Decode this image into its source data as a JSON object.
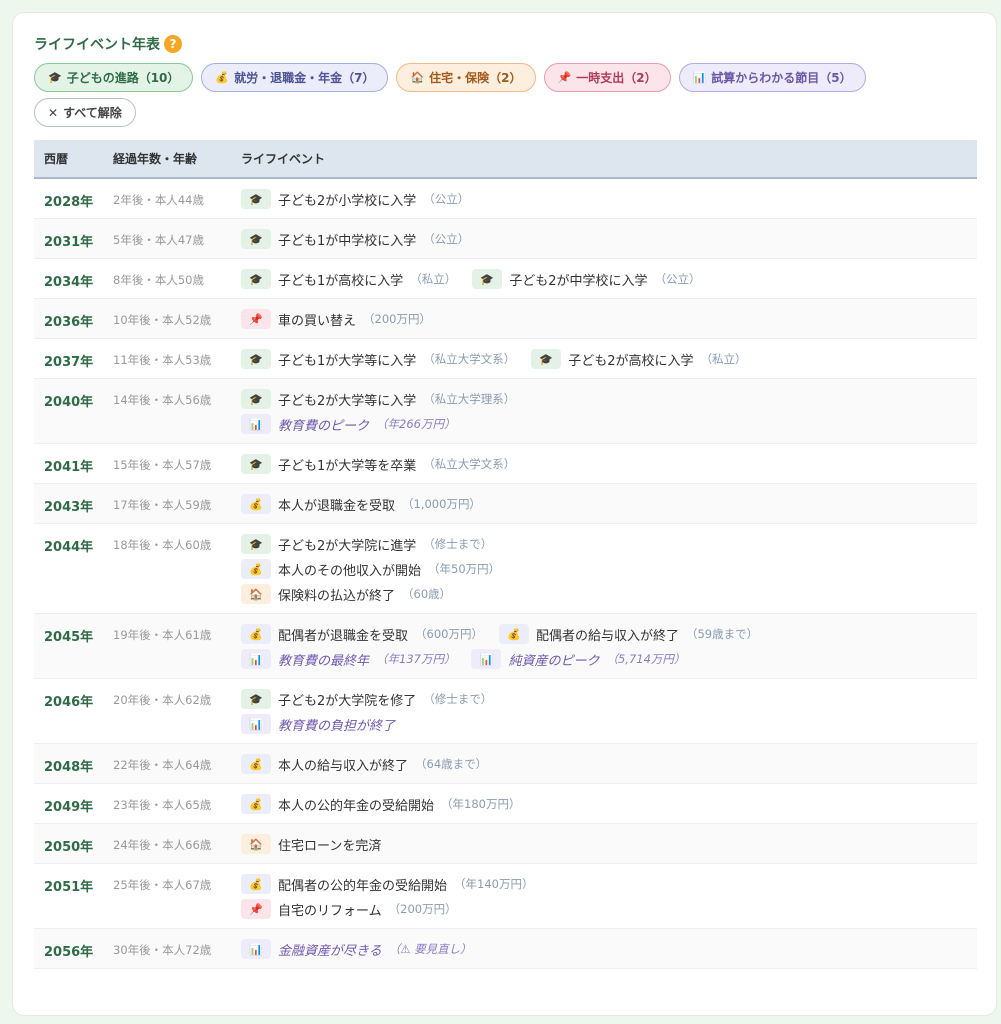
{
  "header": {
    "title": "ライフイベント年表",
    "help_icon": "?"
  },
  "filters": [
    {
      "label": "子どもの進路（10）",
      "kind": "edu",
      "icon": "🎓"
    },
    {
      "label": "就労・退職金・年金（7）",
      "kind": "work",
      "icon": "💰"
    },
    {
      "label": "住宅・保険（2）",
      "kind": "house",
      "icon": "🏠"
    },
    {
      "label": "一時支出（2）",
      "kind": "temp",
      "icon": "📌"
    },
    {
      "label": "試算からわかる節目（5）",
      "kind": "calc",
      "icon": "📊"
    }
  ],
  "clear_button": {
    "icon": "✕",
    "label": "すべて解除"
  },
  "table": {
    "headers": {
      "year": "西暦",
      "age": "経過年数・年齢",
      "event": "ライフイベント"
    },
    "rows": [
      {
        "year": "2028年",
        "age": "2年後・本人44歳",
        "lines": [
          [
            {
              "k": "edu",
              "t": "子ども2が小学校に入学",
              "n": "（公立）"
            }
          ]
        ]
      },
      {
        "year": "2031年",
        "age": "5年後・本人47歳",
        "lines": [
          [
            {
              "k": "edu",
              "t": "子ども1が中学校に入学",
              "n": "（公立）"
            }
          ]
        ]
      },
      {
        "year": "2034年",
        "age": "8年後・本人50歳",
        "lines": [
          [
            {
              "k": "edu",
              "t": "子ども1が高校に入学",
              "n": "（私立）"
            },
            {
              "k": "edu",
              "t": "子ども2が中学校に入学",
              "n": "（公立）"
            }
          ]
        ]
      },
      {
        "year": "2036年",
        "age": "10年後・本人52歳",
        "lines": [
          [
            {
              "k": "temp",
              "t": "車の買い替え",
              "n": "（200万円）"
            }
          ]
        ]
      },
      {
        "year": "2037年",
        "age": "11年後・本人53歳",
        "lines": [
          [
            {
              "k": "edu",
              "t": "子ども1が大学等に入学",
              "n": "（私立大学文系）"
            },
            {
              "k": "edu",
              "t": "子ども2が高校に入学",
              "n": "（私立）"
            }
          ]
        ]
      },
      {
        "year": "2040年",
        "age": "14年後・本人56歳",
        "lines": [
          [
            {
              "k": "edu",
              "t": "子ども2が大学等に入学",
              "n": "（私立大学理系）"
            }
          ],
          [
            {
              "k": "calc",
              "t": "教育費のピーク",
              "n": "（年266万円）"
            }
          ]
        ]
      },
      {
        "year": "2041年",
        "age": "15年後・本人57歳",
        "lines": [
          [
            {
              "k": "edu",
              "t": "子ども1が大学等を卒業",
              "n": "（私立大学文系）"
            }
          ]
        ]
      },
      {
        "year": "2043年",
        "age": "17年後・本人59歳",
        "lines": [
          [
            {
              "k": "work",
              "t": "本人が退職金を受取",
              "n": "（1,000万円）"
            }
          ]
        ]
      },
      {
        "year": "2044年",
        "age": "18年後・本人60歳",
        "lines": [
          [
            {
              "k": "edu",
              "t": "子ども2が大学院に進学",
              "n": "（修士まで）"
            }
          ],
          [
            {
              "k": "work",
              "t": "本人のその他収入が開始",
              "n": "（年50万円）"
            }
          ],
          [
            {
              "k": "house",
              "t": "保険料の払込が終了",
              "n": "（60歳）"
            }
          ]
        ]
      },
      {
        "year": "2045年",
        "age": "19年後・本人61歳",
        "lines": [
          [
            {
              "k": "work",
              "t": "配偶者が退職金を受取",
              "n": "（600万円）"
            },
            {
              "k": "work",
              "t": "配偶者の給与収入が終了",
              "n": "（59歳まで）"
            }
          ],
          [
            {
              "k": "calc",
              "t": "教育費の最終年",
              "n": "（年137万円）"
            },
            {
              "k": "calc",
              "t": "純資産のピーク",
              "n": "（5,714万円）"
            }
          ]
        ]
      },
      {
        "year": "2046年",
        "age": "20年後・本人62歳",
        "lines": [
          [
            {
              "k": "edu",
              "t": "子ども2が大学院を修了",
              "n": "（修士まで）"
            }
          ],
          [
            {
              "k": "calc",
              "t": "教育費の負担が終了",
              "n": ""
            }
          ]
        ]
      },
      {
        "year": "2048年",
        "age": "22年後・本人64歳",
        "lines": [
          [
            {
              "k": "work",
              "t": "本人の給与収入が終了",
              "n": "（64歳まで）"
            }
          ]
        ]
      },
      {
        "year": "2049年",
        "age": "23年後・本人65歳",
        "lines": [
          [
            {
              "k": "work",
              "t": "本人の公的年金の受給開始",
              "n": "（年180万円）"
            }
          ]
        ]
      },
      {
        "year": "2050年",
        "age": "24年後・本人66歳",
        "lines": [
          [
            {
              "k": "house",
              "t": "住宅ローンを完済",
              "n": ""
            }
          ]
        ]
      },
      {
        "year": "2051年",
        "age": "25年後・本人67歳",
        "lines": [
          [
            {
              "k": "work",
              "t": "配偶者の公的年金の受給開始",
              "n": "（年140万円）"
            }
          ],
          [
            {
              "k": "temp",
              "t": "自宅のリフォーム",
              "n": "（200万円）"
            }
          ]
        ]
      },
      {
        "year": "2056年",
        "age": "30年後・本人72歳",
        "lines": [
          [
            {
              "k": "calc",
              "t": "金融資産が尽きる",
              "n": "（⚠ 要見直し）"
            }
          ]
        ]
      }
    ]
  },
  "icons": {
    "edu": "🎓",
    "work": "💰",
    "house": "🏠",
    "temp": "📌",
    "calc": "📊"
  }
}
